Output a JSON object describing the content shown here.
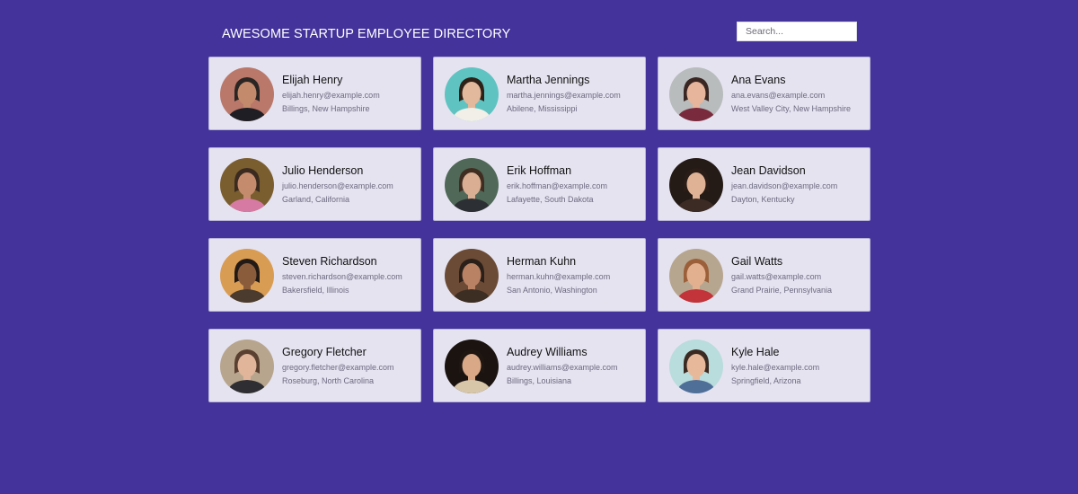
{
  "header": {
    "title": "AWESOME STARTUP EMPLOYEE DIRECTORY",
    "search_placeholder": "Search..."
  },
  "colors": {
    "background": "#43339a",
    "card": "#e5e3f0"
  },
  "employees": [
    {
      "name": "Elijah Henry",
      "email": "elijah.henry@example.com",
      "location": "Billings, New Hampshire",
      "photo": {
        "bg": "#b9786a",
        "skin": "#c48a6c",
        "hair": "#2b2523",
        "shirt": "#1e1e24"
      }
    },
    {
      "name": "Martha Jennings",
      "email": "martha.jennings@example.com",
      "location": "Abilene, Mississippi",
      "photo": {
        "bg": "#5fc3c2",
        "skin": "#e2b99c",
        "hair": "#2d2118",
        "shirt": "#f1efe8"
      }
    },
    {
      "name": "Ana Evans",
      "email": "ana.evans@example.com",
      "location": "West Valley City, New Hampshire",
      "photo": {
        "bg": "#b8bcbd",
        "skin": "#e7b59b",
        "hair": "#3a2622",
        "shirt": "#7a2a3d"
      }
    },
    {
      "name": "Julio Henderson",
      "email": "julio.henderson@example.com",
      "location": "Garland, California",
      "photo": {
        "bg": "#7a5e2f",
        "skin": "#c48b6c",
        "hair": "#3b2a20",
        "shirt": "#d77aa3"
      }
    },
    {
      "name": "Erik Hoffman",
      "email": "erik.hoffman@example.com",
      "location": "Lafayette, South Dakota",
      "photo": {
        "bg": "#4f6857",
        "skin": "#d9ae93",
        "hair": "#3f2d22",
        "shirt": "#2c2f33"
      }
    },
    {
      "name": "Jean Davidson",
      "email": "jean.davidson@example.com",
      "location": "Dayton, Kentucky",
      "photo": {
        "bg": "#241a16",
        "skin": "#dfb295",
        "hair": "#2a1d17",
        "shirt": "#3b2b24"
      }
    },
    {
      "name": "Steven Richardson",
      "email": "steven.richardson@example.com",
      "location": "Bakersfield, Illinois",
      "photo": {
        "bg": "#d99c53",
        "skin": "#8a5c3c",
        "hair": "#231a16",
        "shirt": "#4a3b2e"
      }
    },
    {
      "name": "Herman Kuhn",
      "email": "herman.kuhn@example.com",
      "location": "San Antonio, Washington",
      "photo": {
        "bg": "#6b4b36",
        "skin": "#b98264",
        "hair": "#2a1f19",
        "shirt": "#3d2e24"
      }
    },
    {
      "name": "Gail Watts",
      "email": "gail.watts@example.com",
      "location": "Grand Prairie, Pennsylvania",
      "photo": {
        "bg": "#b7a68f",
        "skin": "#e3b08f",
        "hair": "#9b5f39",
        "shirt": "#c2333a"
      }
    },
    {
      "name": "Gregory Fletcher",
      "email": "gregory.fletcher@example.com",
      "location": "Roseburg, North Carolina",
      "photo": {
        "bg": "#b7a58d",
        "skin": "#e0b59a",
        "hair": "#5a4030",
        "shirt": "#2e2e33"
      }
    },
    {
      "name": "Audrey Williams",
      "email": "audrey.williams@example.com",
      "location": "Billings, Louisiana",
      "photo": {
        "bg": "#1b1310",
        "skin": "#d8a887",
        "hair": "#1f1612",
        "shirt": "#d7c6a8"
      }
    },
    {
      "name": "Kyle Hale",
      "email": "kyle.hale@example.com",
      "location": "Springfield, Arizona",
      "photo": {
        "bg": "#b9dcdc",
        "skin": "#e7b899",
        "hair": "#3a2a22",
        "shirt": "#4f6f99"
      }
    }
  ]
}
